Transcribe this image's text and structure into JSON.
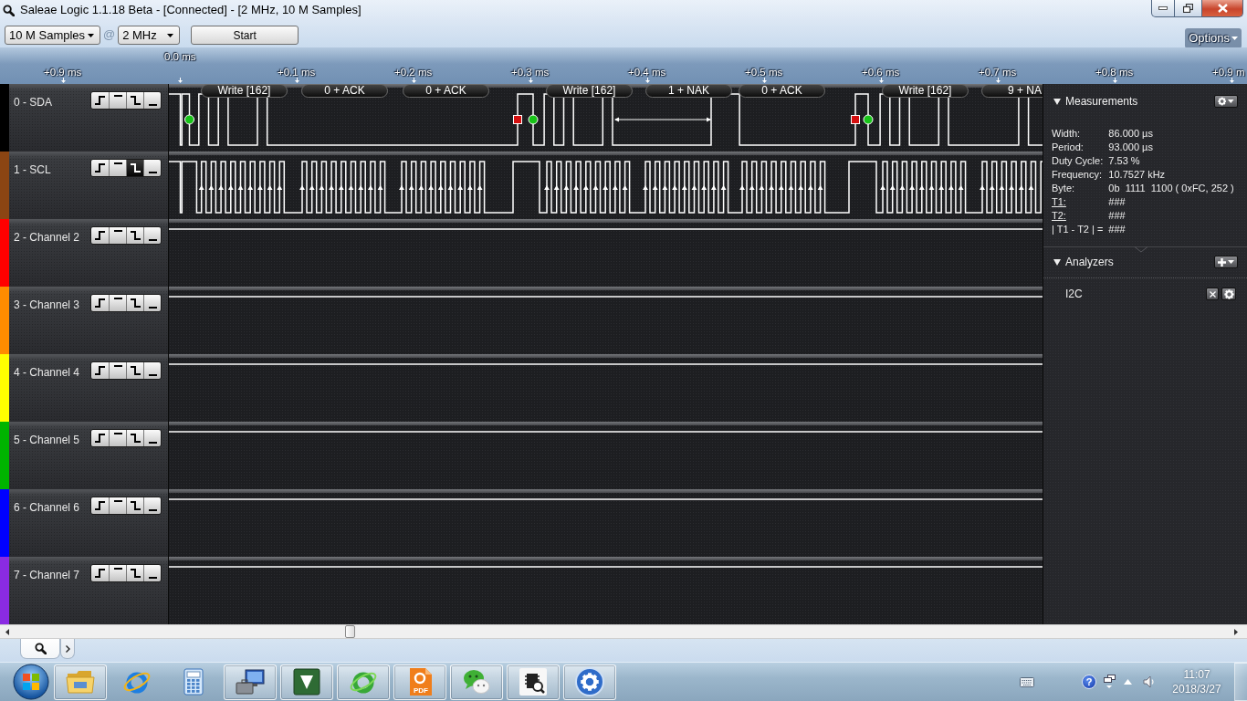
{
  "window": {
    "title": "Saleae Logic 1.1.18 Beta - [Connected] - [2 MHz, 10 M Samples]",
    "maximized": true
  },
  "toolbar": {
    "sample_count": "10 M Samples",
    "at_sign": "@",
    "sample_rate": "2 MHz",
    "start_button": "Start",
    "options_menu": "Options"
  },
  "timeline": {
    "ticks": [
      {
        "label": "+0.9 ms",
        "kind": "offset"
      },
      {
        "label": "0.0 ms",
        "kind": "origin"
      },
      {
        "label": "+0.1 ms",
        "kind": "offset"
      },
      {
        "label": "+0.2 ms",
        "kind": "offset"
      },
      {
        "label": "+0.3 ms",
        "kind": "offset"
      },
      {
        "label": "+0.4 ms",
        "kind": "offset"
      },
      {
        "label": "+0.5 ms",
        "kind": "offset"
      },
      {
        "label": "+0.6 ms",
        "kind": "offset"
      },
      {
        "label": "+0.7 ms",
        "kind": "offset"
      },
      {
        "label": "+0.8 ms",
        "kind": "offset"
      },
      {
        "label": "+0.9 m",
        "kind": "offset"
      }
    ]
  },
  "channels": [
    {
      "label": "0 - SDA",
      "color": "#000000",
      "kind": "data",
      "triggers": [
        {
          "kind": "rising",
          "selected": false
        },
        {
          "kind": "high",
          "selected": false
        },
        {
          "kind": "falling",
          "selected": false
        },
        {
          "kind": "low",
          "selected": false
        }
      ],
      "decoded_frames": [
        "Write [162]",
        "0 + ACK",
        "0 + ACK",
        "Write [162]",
        "1 + NAK",
        "0 + ACK",
        "Write [162]",
        "9 + NA"
      ]
    },
    {
      "label": "1 - SCL",
      "color": "#8b4513",
      "kind": "clock",
      "triggers": [
        {
          "kind": "rising",
          "selected": false
        },
        {
          "kind": "high",
          "selected": false
        },
        {
          "kind": "falling",
          "selected": true
        },
        {
          "kind": "low",
          "selected": false
        }
      ]
    },
    {
      "label": "2 - Channel 2",
      "color": "#ff0000",
      "kind": "idle",
      "triggers": [
        {
          "kind": "rising",
          "selected": false
        },
        {
          "kind": "high",
          "selected": false
        },
        {
          "kind": "falling",
          "selected": false
        },
        {
          "kind": "low",
          "selected": false
        }
      ]
    },
    {
      "label": "3 - Channel 3",
      "color": "#ff8c00",
      "kind": "idle",
      "triggers": [
        {
          "kind": "rising",
          "selected": false
        },
        {
          "kind": "high",
          "selected": false
        },
        {
          "kind": "falling",
          "selected": false
        },
        {
          "kind": "low",
          "selected": false
        }
      ]
    },
    {
      "label": "4 - Channel 4",
      "color": "#ffff00",
      "kind": "idle",
      "triggers": [
        {
          "kind": "rising",
          "selected": false
        },
        {
          "kind": "high",
          "selected": false
        },
        {
          "kind": "falling",
          "selected": false
        },
        {
          "kind": "low",
          "selected": false
        }
      ]
    },
    {
      "label": "5 - Channel 5",
      "color": "#00b400",
      "kind": "idle",
      "triggers": [
        {
          "kind": "rising",
          "selected": false
        },
        {
          "kind": "high",
          "selected": false
        },
        {
          "kind": "falling",
          "selected": false
        },
        {
          "kind": "low",
          "selected": false
        }
      ]
    },
    {
      "label": "6 - Channel 6",
      "color": "#0000ff",
      "kind": "idle",
      "triggers": [
        {
          "kind": "rising",
          "selected": false
        },
        {
          "kind": "high",
          "selected": false
        },
        {
          "kind": "falling",
          "selected": false
        },
        {
          "kind": "low",
          "selected": false
        }
      ]
    },
    {
      "label": "7 - Channel 7",
      "color": "#8a2be2",
      "kind": "idle",
      "triggers": [
        {
          "kind": "rising",
          "selected": false
        },
        {
          "kind": "high",
          "selected": false
        },
        {
          "kind": "falling",
          "selected": false
        },
        {
          "kind": "low",
          "selected": false
        }
      ]
    }
  ],
  "measurements": {
    "title": "Measurements",
    "expanded": true,
    "rows": [
      {
        "label": "Width:",
        "value": "86.000 µs",
        "kind": "plain"
      },
      {
        "label": "Period:",
        "value": "93.000 µs",
        "kind": "plain"
      },
      {
        "label": "Duty Cycle:",
        "value": "7.53 %",
        "kind": "plain"
      },
      {
        "label": "Frequency:",
        "value": "10.7527 kHz",
        "kind": "plain"
      },
      {
        "label": "Byte:",
        "value": "0b  1111  1100 ( 0xFC, 252 )",
        "kind": "plain"
      },
      {
        "label": "T1:",
        "value": "###",
        "kind": "link"
      },
      {
        "label": "T2:",
        "value": "###",
        "kind": "link"
      },
      {
        "label": "| T1 - T2 | =",
        "value": "###",
        "kind": "plain"
      }
    ]
  },
  "analyzers": {
    "title": "Analyzers",
    "expanded": true,
    "items": [
      {
        "name": "I2C"
      }
    ]
  },
  "tabs": [
    {
      "kind": "search",
      "selected": true
    },
    {
      "kind": "more",
      "selected": false
    }
  ],
  "taskbar": {
    "apps": [
      {
        "kind": "folder",
        "running": true
      },
      {
        "kind": "globe",
        "running": false
      },
      {
        "kind": "calculator",
        "running": false
      },
      {
        "kind": "toolbox",
        "running": true
      },
      {
        "kind": "ide",
        "running": true
      },
      {
        "kind": "leafglobe",
        "running": true
      },
      {
        "kind": "pdf",
        "running": true,
        "label": "PDF"
      },
      {
        "kind": "chat",
        "running": true
      },
      {
        "kind": "chip",
        "running": true
      },
      {
        "kind": "gear",
        "running": true
      }
    ],
    "tray": [
      {
        "kind": "keyboard"
      },
      {
        "kind": "help",
        "glyph": "?"
      },
      {
        "kind": "windows"
      },
      {
        "kind": "overflow"
      },
      {
        "kind": "speaker"
      }
    ],
    "clock": {
      "time": "11:07",
      "date": "2018/3/27"
    }
  }
}
